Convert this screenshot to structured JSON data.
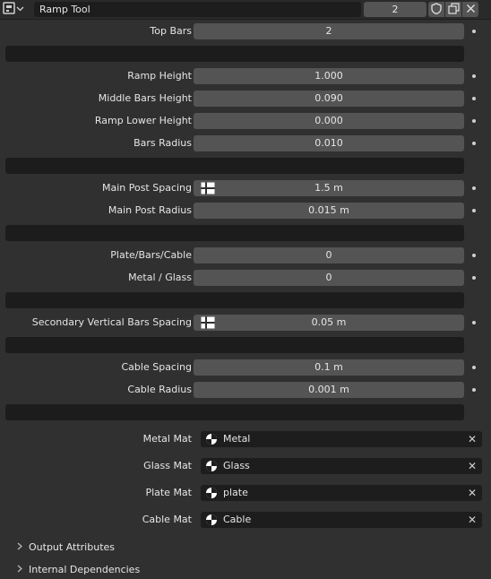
{
  "header": {
    "node_name": "Ramp Tool",
    "users": "2"
  },
  "fields": [
    {
      "label": "Top Bars",
      "value": "2"
    },
    {
      "label": "Ramp Height",
      "value": "1.000"
    },
    {
      "label": "Middle Bars Height",
      "value": "0.090"
    },
    {
      "label": "Ramp Lower Height",
      "value": "0.000"
    },
    {
      "label": "Bars Radius",
      "value": "0.010"
    },
    {
      "label": "Main Post Spacing",
      "value": "1.5 m"
    },
    {
      "label": "Main Post Radius",
      "value": "0.015 m"
    },
    {
      "label": "Plate/Bars/Cable",
      "value": "0"
    },
    {
      "label": "Metal / Glass",
      "value": "0"
    },
    {
      "label": "Secondary Vertical Bars Spacing",
      "value": "0.05 m"
    },
    {
      "label": "Cable Spacing",
      "value": "0.1 m"
    },
    {
      "label": "Cable Radius",
      "value": "0.001 m"
    }
  ],
  "materials": [
    {
      "label": "Metal Mat",
      "value": "Metal"
    },
    {
      "label": "Glass Mat",
      "value": "Glass"
    },
    {
      "label": "Plate Mat",
      "value": "plate"
    },
    {
      "label": "Cable Mat",
      "value": "Cable"
    }
  ],
  "subpanels": [
    {
      "label": "Output Attributes"
    },
    {
      "label": "Internal Dependencies"
    }
  ]
}
